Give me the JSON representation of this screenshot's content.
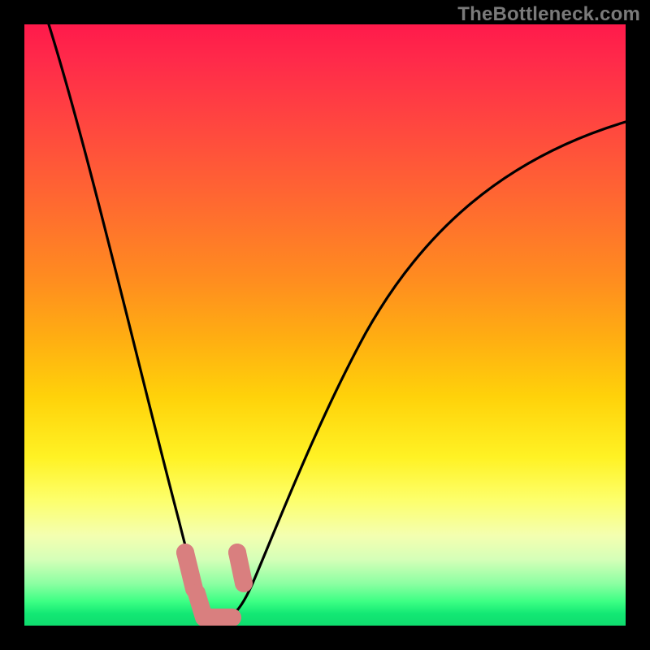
{
  "watermark": "TheBottleneck.com",
  "colors": {
    "background": "#000000",
    "gradient_top": "#ff1a4b",
    "gradient_bottom": "#0fdc6e",
    "curve": "#000000",
    "marker": "#d97f7f"
  },
  "chart_data": {
    "type": "line",
    "title": "",
    "xlabel": "",
    "ylabel": "",
    "xlim": [
      0,
      100
    ],
    "ylim": [
      0,
      100
    ],
    "annotations": [],
    "series": [
      {
        "name": "bottleneck-curve",
        "x": [
          0,
          5,
          10,
          15,
          20,
          23,
          26,
          28,
          30,
          32,
          35,
          40,
          45,
          50,
          55,
          60,
          70,
          80,
          90,
          100
        ],
        "y": [
          100,
          82,
          64,
          46,
          28,
          16,
          6,
          1,
          0,
          1,
          6,
          18,
          30,
          40,
          48,
          55,
          66,
          74,
          80,
          84
        ]
      }
    ],
    "markers": [
      {
        "name": "left-marker-top",
        "x": 25.5,
        "y": 10
      },
      {
        "name": "left-marker-bottom",
        "x": 27,
        "y": 1
      },
      {
        "name": "right-marker-top",
        "x": 33,
        "y": 10
      },
      {
        "name": "valley-marker",
        "x": 30,
        "y": 0
      }
    ],
    "background_gradient": {
      "orientation": "vertical",
      "stops": [
        {
          "pos": 0.0,
          "color": "#ff1a4b"
        },
        {
          "pos": 0.3,
          "color": "#ff6a30"
        },
        {
          "pos": 0.62,
          "color": "#ffd20a"
        },
        {
          "pos": 0.8,
          "color": "#fdff6a"
        },
        {
          "pos": 0.93,
          "color": "#8cffa2"
        },
        {
          "pos": 1.0,
          "color": "#0fdc6e"
        }
      ]
    }
  }
}
